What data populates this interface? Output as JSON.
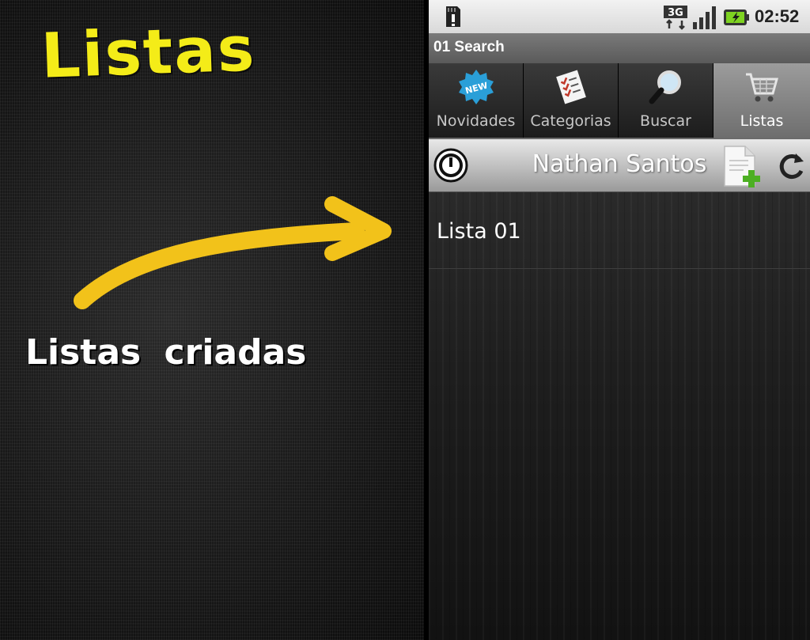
{
  "promo": {
    "title": "Listas",
    "caption": "Listas criadas",
    "accent_color": "#f4ec18"
  },
  "status_bar": {
    "time": "02:52",
    "network": "3G",
    "icons": [
      "sd-card-warning-icon",
      "3g-data-icon",
      "signal-icon",
      "battery-charging-icon"
    ]
  },
  "app": {
    "title": "01 Search"
  },
  "tabs": [
    {
      "label": "Novidades",
      "icon": "new-badge-icon",
      "active": false
    },
    {
      "label": "Categorias",
      "icon": "checklist-icon",
      "active": false
    },
    {
      "label": "Buscar",
      "icon": "magnifier-icon",
      "active": false
    },
    {
      "label": "Listas",
      "icon": "shopping-cart-icon",
      "active": true
    }
  ],
  "user_bar": {
    "name": "Nathan Santos",
    "icons": [
      "power-icon",
      "add-list-icon",
      "refresh-icon"
    ]
  },
  "lists": [
    {
      "label": "Lista 01"
    }
  ]
}
